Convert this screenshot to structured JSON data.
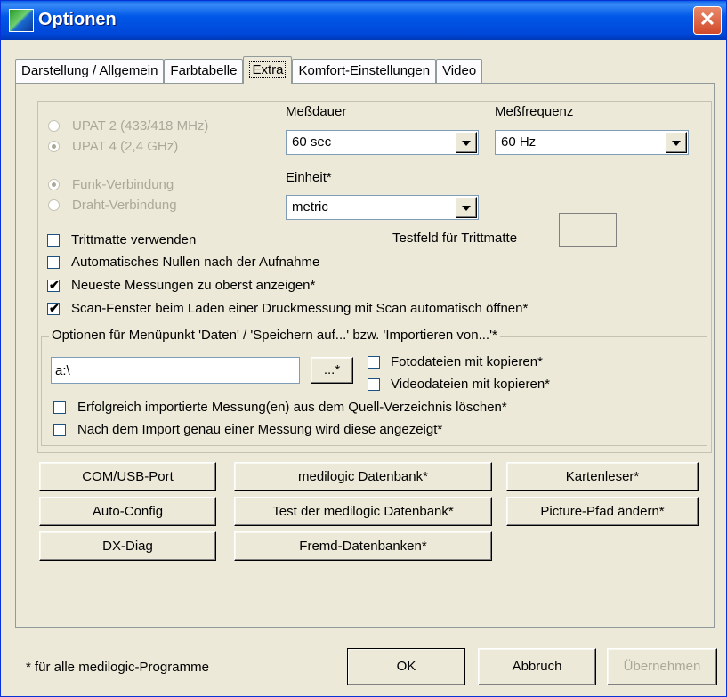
{
  "window": {
    "title": "Optionen",
    "close_glyph": "✕"
  },
  "tabs": [
    {
      "label": "Darstellung / Allgemein",
      "active": false
    },
    {
      "label": "Farbtabelle",
      "active": false
    },
    {
      "label": "Extra",
      "active": true
    },
    {
      "label": "Komfort-Einstellungen",
      "active": false
    },
    {
      "label": "Video",
      "active": false
    }
  ],
  "extra": {
    "radio_upat": [
      {
        "label": "UPAT 2 (433/418 MHz)",
        "checked": false
      },
      {
        "label": "UPAT 4 (2,4 GHz)",
        "checked": true
      }
    ],
    "radio_connection": [
      {
        "label": "Funk-Verbindung",
        "checked": true
      },
      {
        "label": "Draht-Verbindung",
        "checked": false
      }
    ],
    "messdauer": {
      "label": "Meßdauer",
      "value": "60  sec"
    },
    "messfrequenz": {
      "label": "Meßfrequenz",
      "value": "60  Hz"
    },
    "einheit": {
      "label": "Einheit*",
      "value": "metric"
    },
    "testfeld_label": "Testfeld für Trittmatte",
    "checkboxes": [
      {
        "label": "Trittmatte verwenden",
        "checked": false
      },
      {
        "label": "Automatisches Nullen nach der Aufnahme",
        "checked": false
      },
      {
        "label": "Neueste Messungen zu oberst anzeigen*",
        "checked": true
      },
      {
        "label": "Scan-Fenster beim Laden einer Druckmessung mit Scan automatisch öffnen*",
        "checked": true
      }
    ],
    "import_group": {
      "legend": "Optionen für Menüpunkt 'Daten' / 'Speichern auf...' bzw. 'Importieren von...'*",
      "path_value": "a:\\",
      "browse_label": "...*",
      "foto_label": "Fotodateien mit kopieren*",
      "video_label": "Videodateien mit kopieren*",
      "delete_label": "Erfolgreich importierte Messung(en) aus dem Quell-Verzeichnis löschen*",
      "show_label": "Nach dem Import genau einer Messung wird diese angezeigt*"
    },
    "buttons": {
      "com_usb": "COM/USB-Port",
      "medilogic_db": "medilogic Datenbank*",
      "kartenleser": "Kartenleser*",
      "auto_config": "Auto-Config",
      "test_db": "Test der medilogic Datenbank*",
      "picture_pfad": "Picture-Pfad ändern*",
      "dx_diag": "DX-Diag",
      "fremd_db": "Fremd-Datenbanken*"
    }
  },
  "footer": {
    "note": "* für alle medilogic-Programme",
    "ok": "OK",
    "abbruch": "Abbruch",
    "uebernehmen": "Übernehmen"
  }
}
